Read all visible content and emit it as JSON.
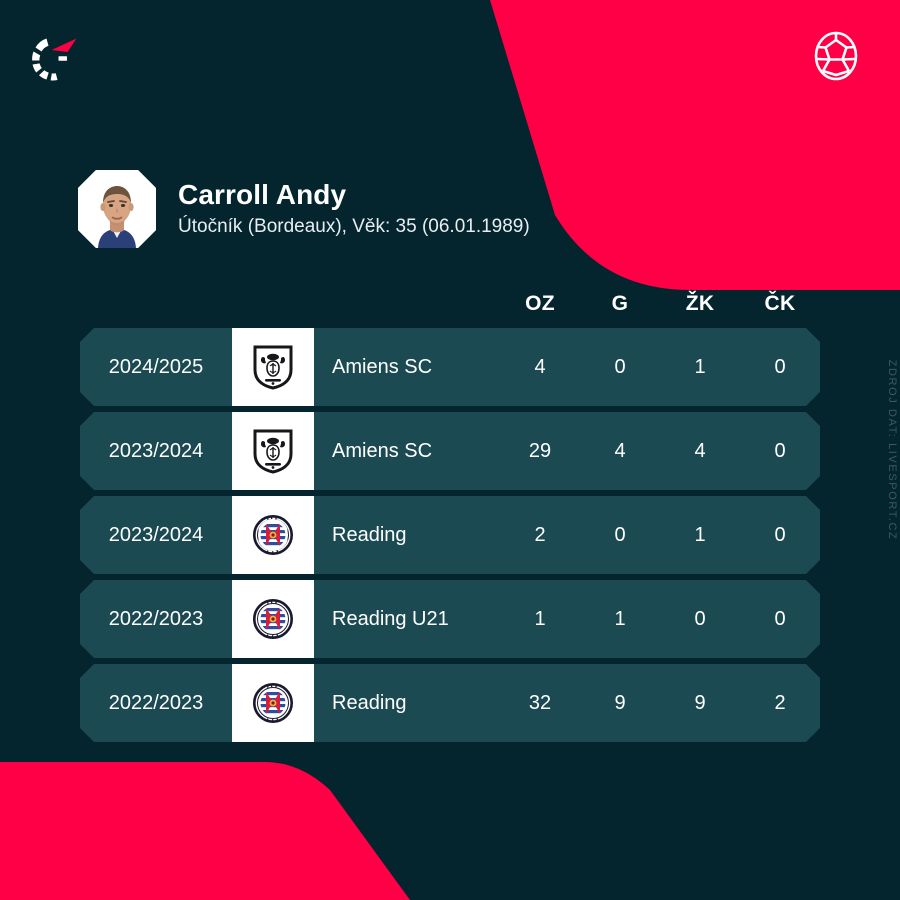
{
  "theme": {
    "background": "#04242e",
    "accent_red": "#ff0046",
    "row_background": "#1b4a53",
    "text_primary": "#ffffff",
    "watermark_color": "#3a5a63"
  },
  "header": {
    "brand_logo_icon": "livesport-logo-icon",
    "ball_icon": "soccer-ball-icon"
  },
  "player": {
    "photo_icon": "player-photo",
    "name": "Carroll Andy",
    "meta": "Útočník (Bordeaux), Věk: 35 (06.01.1989)"
  },
  "stats_table": {
    "columns": [
      "OZ",
      "G",
      "ŽK",
      "ČK"
    ],
    "rows": [
      {
        "season": "2024/2025",
        "crest": "amiens-sc-crest-icon",
        "team": "Amiens SC",
        "oz": "4",
        "g": "0",
        "zk": "1",
        "ck": "0"
      },
      {
        "season": "2023/2024",
        "crest": "amiens-sc-crest-icon",
        "team": "Amiens SC",
        "oz": "29",
        "g": "4",
        "zk": "4",
        "ck": "0"
      },
      {
        "season": "2023/2024",
        "crest": "reading-crest-icon",
        "team": "Reading",
        "oz": "2",
        "g": "0",
        "zk": "1",
        "ck": "0"
      },
      {
        "season": "2022/2023",
        "crest": "reading-crest-icon",
        "team": "Reading U21",
        "oz": "1",
        "g": "1",
        "zk": "0",
        "ck": "0"
      },
      {
        "season": "2022/2023",
        "crest": "reading-crest-icon",
        "team": "Reading",
        "oz": "32",
        "g": "9",
        "zk": "9",
        "ck": "2"
      }
    ]
  },
  "watermark": {
    "text": "ZDROJ DAT: LIVESPORT.CZ"
  }
}
